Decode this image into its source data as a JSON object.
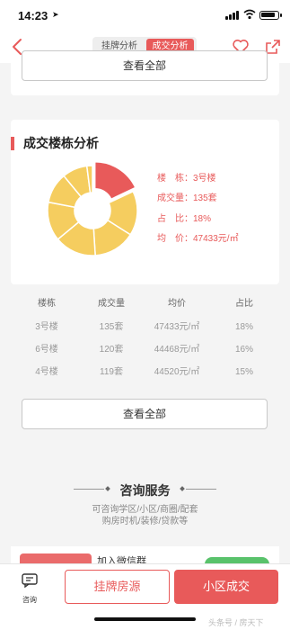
{
  "status": {
    "time": "14:23",
    "location_icon": "location-arrow-icon"
  },
  "nav": {
    "tabs": [
      "挂牌分析",
      "成交分析"
    ],
    "active_tab": "成交分析",
    "icons": [
      "back-icon",
      "heart-icon",
      "share-icon"
    ]
  },
  "top_card": {
    "view_all": "查看全部"
  },
  "building_analysis": {
    "title": "成交楼栋分析",
    "pie_slices": [
      {
        "building": "3号楼",
        "share": 18,
        "color": "#e85a5a"
      },
      {
        "building": "6号楼",
        "share": 16,
        "color": "#f5cd5f"
      },
      {
        "building": "4号楼",
        "share": 15,
        "color": "#f5cd5f"
      },
      {
        "building": "",
        "share": 15,
        "color": "#f5cd5f"
      },
      {
        "building": "",
        "share": 14,
        "color": "#f5cd5f"
      },
      {
        "building": "",
        "share": 11,
        "color": "#f5cd5f"
      },
      {
        "building": "",
        "share": 9,
        "color": "#f5cd5f"
      },
      {
        "building": "",
        "share": 2,
        "color": "#f5cd5f"
      }
    ],
    "info": {
      "building": "楼　栋：3号楼",
      "volume": "成交量：135套",
      "ratio": "占　比：18%",
      "price": "均　价：47433元/㎡"
    }
  },
  "table": {
    "headers": [
      "楼栋",
      "成交量",
      "均价",
      "占比"
    ],
    "rows": [
      [
        "3号楼",
        "135套",
        "47433元/㎡",
        "18%"
      ],
      [
        "6号楼",
        "120套",
        "44468元/㎡",
        "16%"
      ],
      [
        "4号楼",
        "119套",
        "44520元/㎡",
        "15%"
      ]
    ],
    "view_all": "查看全部"
  },
  "consult": {
    "title": "咨询服务",
    "sub1": "可咨询学区/小区/商圈/配套",
    "sub2": "购房时机/装修/贷款等",
    "wechat_text": "加入微信群"
  },
  "bottom": {
    "consult_label": "咨询",
    "btn_listing": "挂牌房源",
    "btn_deal": "小区成交",
    "watermark": "头条号 / 房天下"
  },
  "colors": {
    "accent": "#e85a5a",
    "pie_yellow": "#f5cd5f"
  }
}
